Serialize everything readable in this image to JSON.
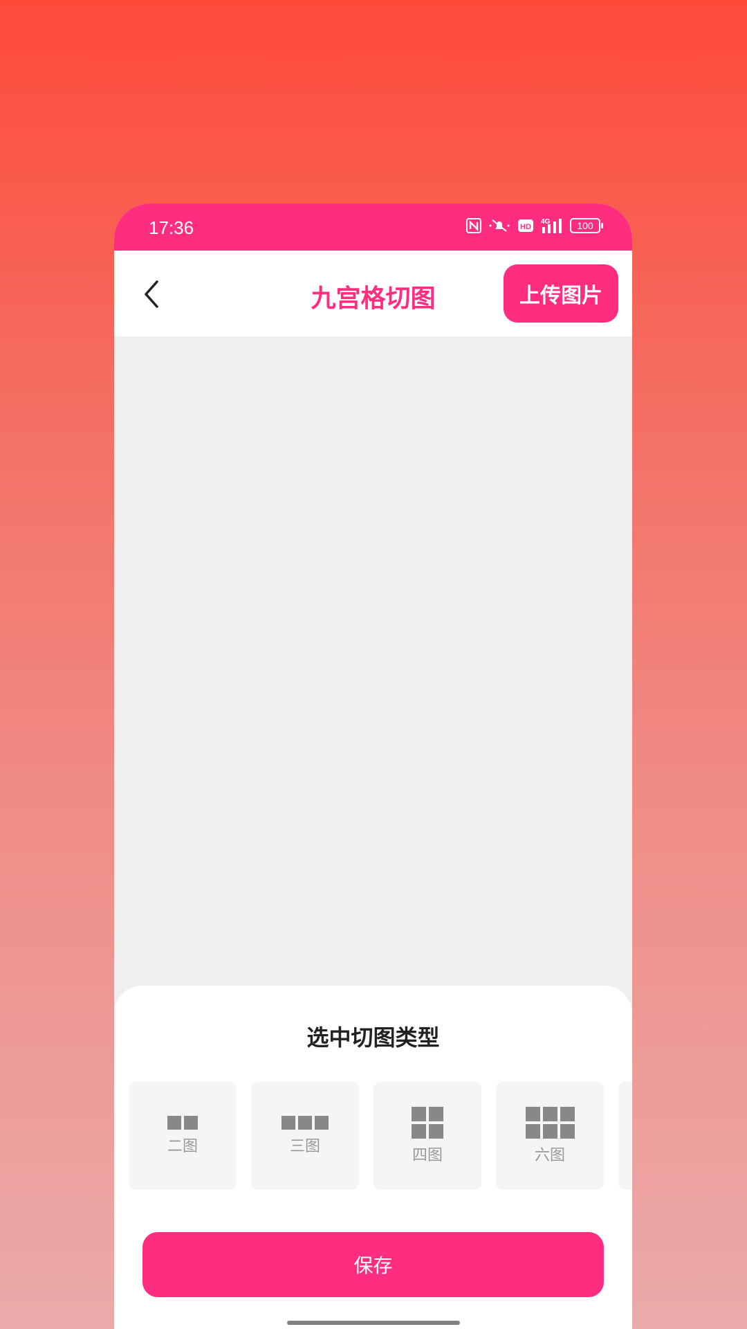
{
  "status_bar": {
    "time": "17:36",
    "battery": "100",
    "hd_label": "HD",
    "network_label": "4G",
    "icons": [
      "nfc-icon",
      "mute-icon",
      "hd-icon",
      "signal-4g-icon",
      "battery-icon"
    ]
  },
  "header": {
    "title": "九宫格切图",
    "upload_label": "上传图片",
    "back_icon": "back-arrow-icon"
  },
  "sheet": {
    "title": "选中切图类型",
    "types": [
      {
        "label": "二图",
        "icon": "grid-2-icon"
      },
      {
        "label": "三图",
        "icon": "grid-3-icon"
      },
      {
        "label": "四图",
        "icon": "grid-4-icon"
      },
      {
        "label": "六图",
        "icon": "grid-6-icon"
      }
    ],
    "save_label": "保存"
  },
  "colors": {
    "accent": "#ff2d80",
    "canvas": "#efefef",
    "icon_gray": "#888888"
  }
}
